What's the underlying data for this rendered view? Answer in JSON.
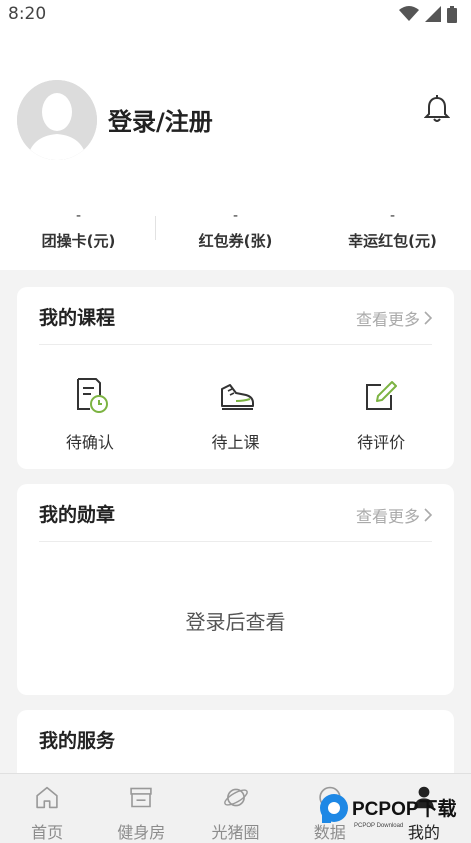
{
  "status_bar": {
    "time": "8:20"
  },
  "header": {
    "login_text": "登录/注册",
    "stats": [
      {
        "value": "-",
        "label": "团操卡(元)"
      },
      {
        "value": "-",
        "label": "红包券(张)"
      },
      {
        "value": "-",
        "label": "幸运红包(元)"
      }
    ]
  },
  "courses": {
    "title": "我的课程",
    "more": "查看更多",
    "items": [
      {
        "label": "待确认",
        "icon": "pending-confirm-icon"
      },
      {
        "label": "待上课",
        "icon": "sneaker-icon"
      },
      {
        "label": "待评价",
        "icon": "edit-review-icon"
      }
    ]
  },
  "badges": {
    "title": "我的勋章",
    "more": "查看更多",
    "empty_text": "登录后查看"
  },
  "services": {
    "title": "我的服务"
  },
  "tabbar": {
    "tabs": [
      {
        "label": "首页",
        "icon": "home-icon"
      },
      {
        "label": "健身房",
        "icon": "store-icon"
      },
      {
        "label": "光猪圈",
        "icon": "planet-icon"
      },
      {
        "label": "数据",
        "icon": "data-icon"
      },
      {
        "label": "我的",
        "icon": "person-icon",
        "active": true
      }
    ]
  },
  "watermark": {
    "text": "PCPOP下载",
    "subtext": "PCPOP Download"
  },
  "colors": {
    "accent_green": "#7cb342",
    "icon_dark": "#333333",
    "muted_text": "#aaaaaa"
  }
}
